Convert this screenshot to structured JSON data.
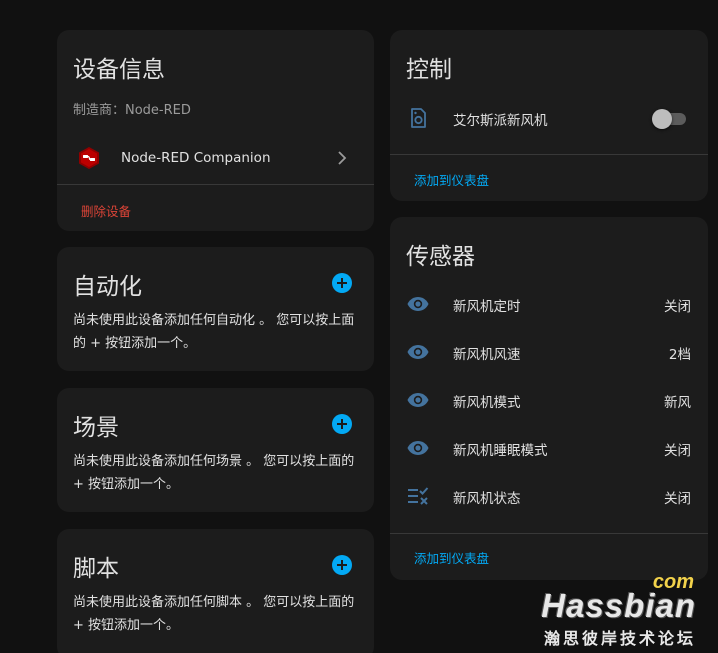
{
  "device_info": {
    "title": "设备信息",
    "manufacturer": "制造商：Node-RED",
    "integration_name": "Node-RED Companion",
    "delete_label": "删除设备"
  },
  "automation": {
    "title": "自动化",
    "description": "尚未使用此设备添加任何自动化 。 您可以按上面的 + 按钮添加一个。"
  },
  "scene": {
    "title": "场景",
    "description": "尚未使用此设备添加任何场景 。 您可以按上面的 + 按钮添加一个。"
  },
  "script": {
    "title": "脚本",
    "description": "尚未使用此设备添加任何脚本 。 您可以按上面的 + 按钮添加一个。"
  },
  "controls": {
    "title": "控制",
    "items": [
      {
        "name": "艾尔斯派新风机",
        "icon": "switch-icon",
        "state": "off"
      }
    ],
    "add_dashboard_label": "添加到仪表盘"
  },
  "sensors": {
    "title": "传感器",
    "items": [
      {
        "name": "新风机定时",
        "value": "关闭",
        "icon": "eye-icon"
      },
      {
        "name": "新风机风速",
        "value": "2档",
        "icon": "eye-icon"
      },
      {
        "name": "新风机模式",
        "value": "新风",
        "icon": "eye-icon"
      },
      {
        "name": "新风机睡眠模式",
        "value": "关闭",
        "icon": "eye-icon"
      },
      {
        "name": "新风机状态",
        "value": "关闭",
        "icon": "list-status-icon"
      }
    ],
    "add_dashboard_label": "添加到仪表盘"
  },
  "watermark": {
    "com": "com",
    "brand": "Hassbian",
    "subtitle": "瀚思彼岸技术论坛"
  },
  "colors": {
    "accent": "#03a9f4",
    "danger": "#db4437",
    "icon": "#44739e",
    "card": "#1c1c1c",
    "background": "#111111"
  }
}
